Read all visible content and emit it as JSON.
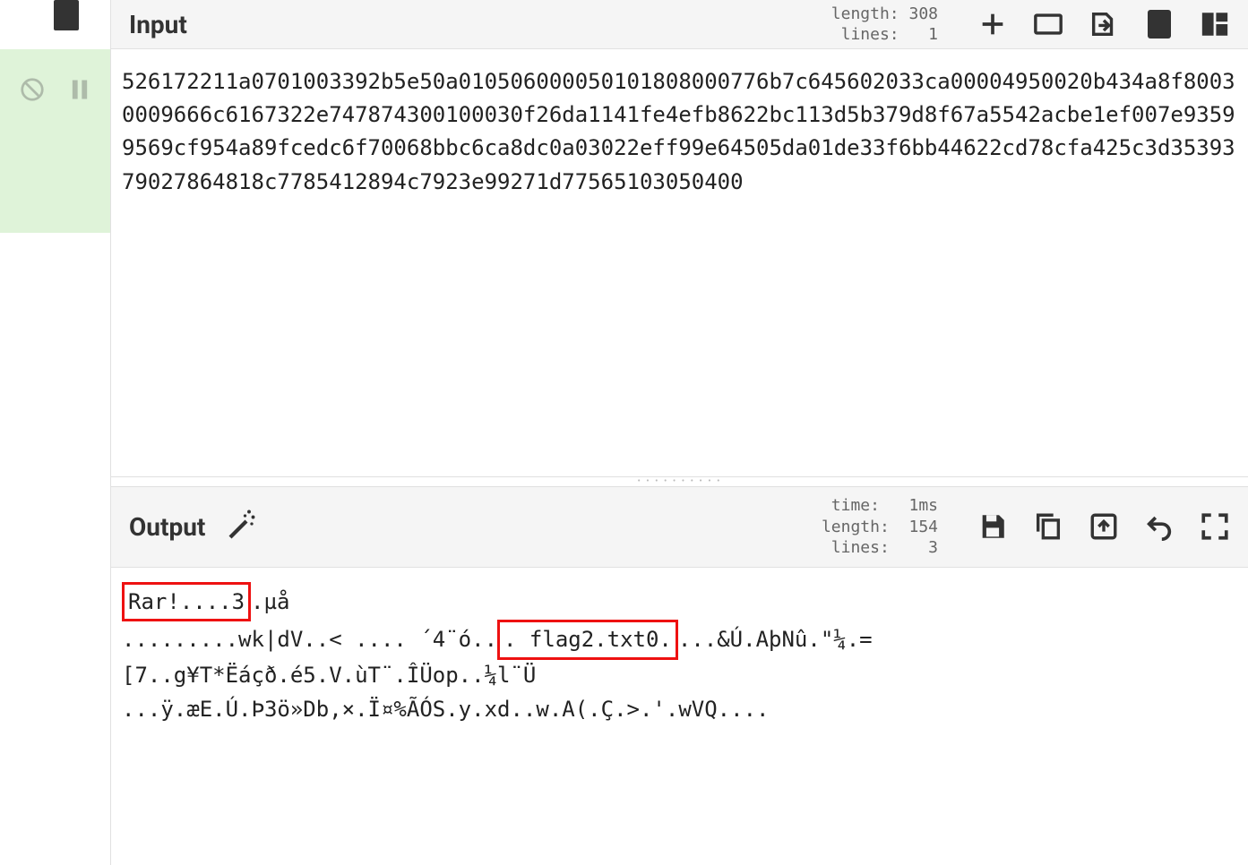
{
  "input": {
    "title": "Input",
    "stats_top": "length: 308",
    "stats_bottom": "lines:   1",
    "text": "526172211a0701003392b5e50a010506000050101808000776b7c645602033ca00004950020b434a8f80030009666c6167322e747874300100030f26da1141fe4efb8622bc113d5b379d8f67a5542acbe1ef007e93599569cf954a89fcedc6f70068bbc6ca8dc0a03022eff99e64505da01de33f6bb44622cd78cfa425c3d3539379027864818c7785412894c7923e99271d77565103050400"
  },
  "output": {
    "title": "Output",
    "stats_time": "time:   1ms",
    "stats_length": "length:  154",
    "stats_lines": "lines:    3",
    "seg_rar": "Rar!....3",
    "seg_after_rar": ".µå",
    "seg_before_flag": ".........wk|dV..< ....  ´4¨ó..",
    "seg_flag": ". flag2.txt0.",
    "seg_after_flag": "...&Ú.AþNû.\"¼.=",
    "line3": "[7..g¥T*Ëáçð.é5.V.ùT¨.ÎÜop..¼l¨Ü",
    "line4": "...ÿ.æE.Ú.Þ3ö»Db,×.Ï¤%ÃÓS.y.xd..w.A(.Ç.>.'.wVQ...."
  }
}
